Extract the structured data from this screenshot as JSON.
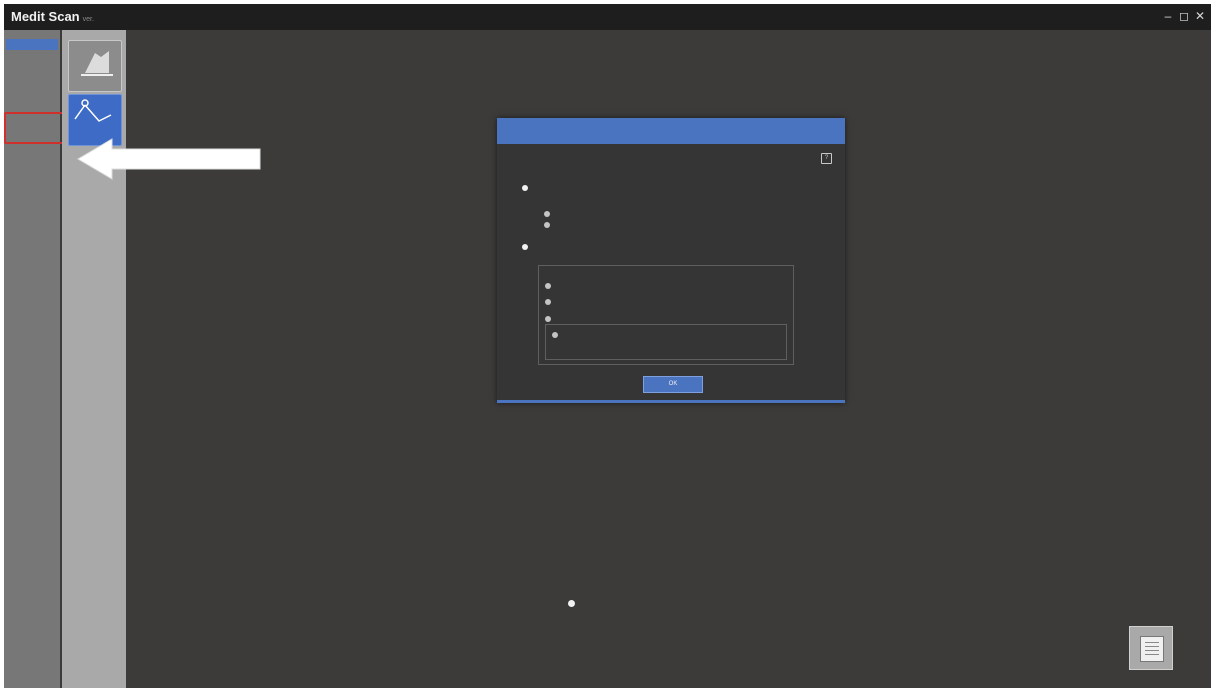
{
  "window": {
    "title": "Medit Scan",
    "version_tag": "ver.",
    "controls": [
      "–",
      "◻",
      "✕"
    ]
  },
  "sidebar": {
    "header": "",
    "items": [
      {
        "label": ""
      },
      {
        "label": ""
      },
      {
        "label": ""
      },
      {
        "label": ""
      }
    ],
    "highlighted_index": 3,
    "highlight_color": "#d0302c"
  },
  "toolbar": {
    "tools": [
      {
        "label": "",
        "icon": "scan-icon"
      },
      {
        "label": "",
        "icon": "edit-icon"
      }
    ]
  },
  "dialog": {
    "title": "",
    "help_icon": "?",
    "option_a": {
      "label": "",
      "suboptions": [
        "",
        ""
      ]
    },
    "option_b": {
      "label": "",
      "group_title": "",
      "items": [
        "",
        "",
        ""
      ],
      "nested_item": "",
      "nested_note": ""
    },
    "ok_button": "OK"
  },
  "bottom_option": {
    "label": ""
  },
  "corner_button": {
    "icon": "document-icon"
  },
  "colors": {
    "accent": "#4a73c0",
    "background": "#3c3b3a",
    "titlebar": "#1e1e1e",
    "highlight": "#d0302c"
  }
}
